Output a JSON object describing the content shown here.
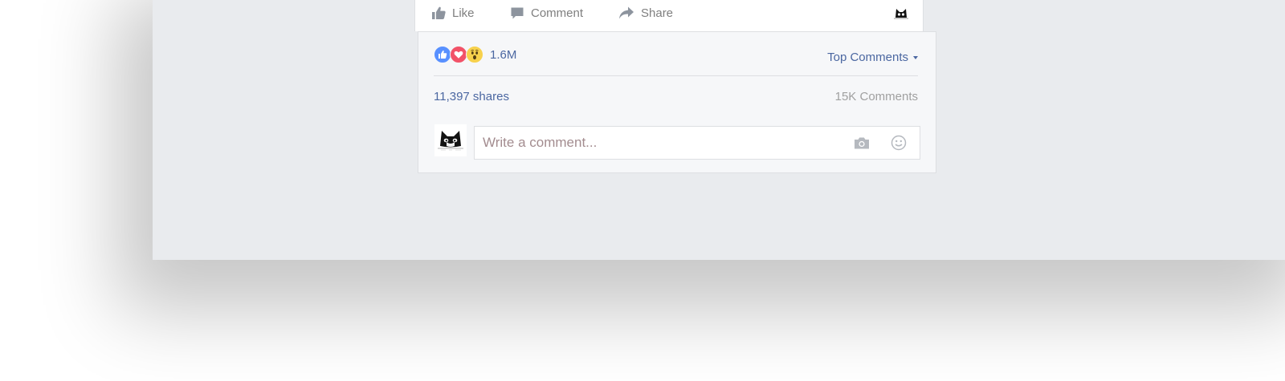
{
  "post_actions": {
    "like_label": "Like",
    "comment_label": "Comment",
    "share_label": "Share"
  },
  "reactions": {
    "types": [
      "like",
      "love",
      "wow"
    ],
    "count": "1.6M"
  },
  "comments_filter": {
    "label": "Top Comments"
  },
  "stats": {
    "shares": "11,397 shares",
    "comments": "15K Comments"
  },
  "composer": {
    "placeholder": "Write a comment...",
    "value": ""
  },
  "icons": {
    "like": "thumbs-up-icon",
    "comment": "speech-bubble-icon",
    "share": "share-arrow-icon",
    "camera": "camera-icon",
    "emoji": "smiley-icon"
  },
  "colors": {
    "link_blue": "#4b67a1",
    "like_blue": "#5890ff",
    "love_red": "#f25268",
    "wow_yellow": "#f7d14c",
    "panel_bg": "#f6f7f9",
    "page_bg": "#e9ebee"
  }
}
